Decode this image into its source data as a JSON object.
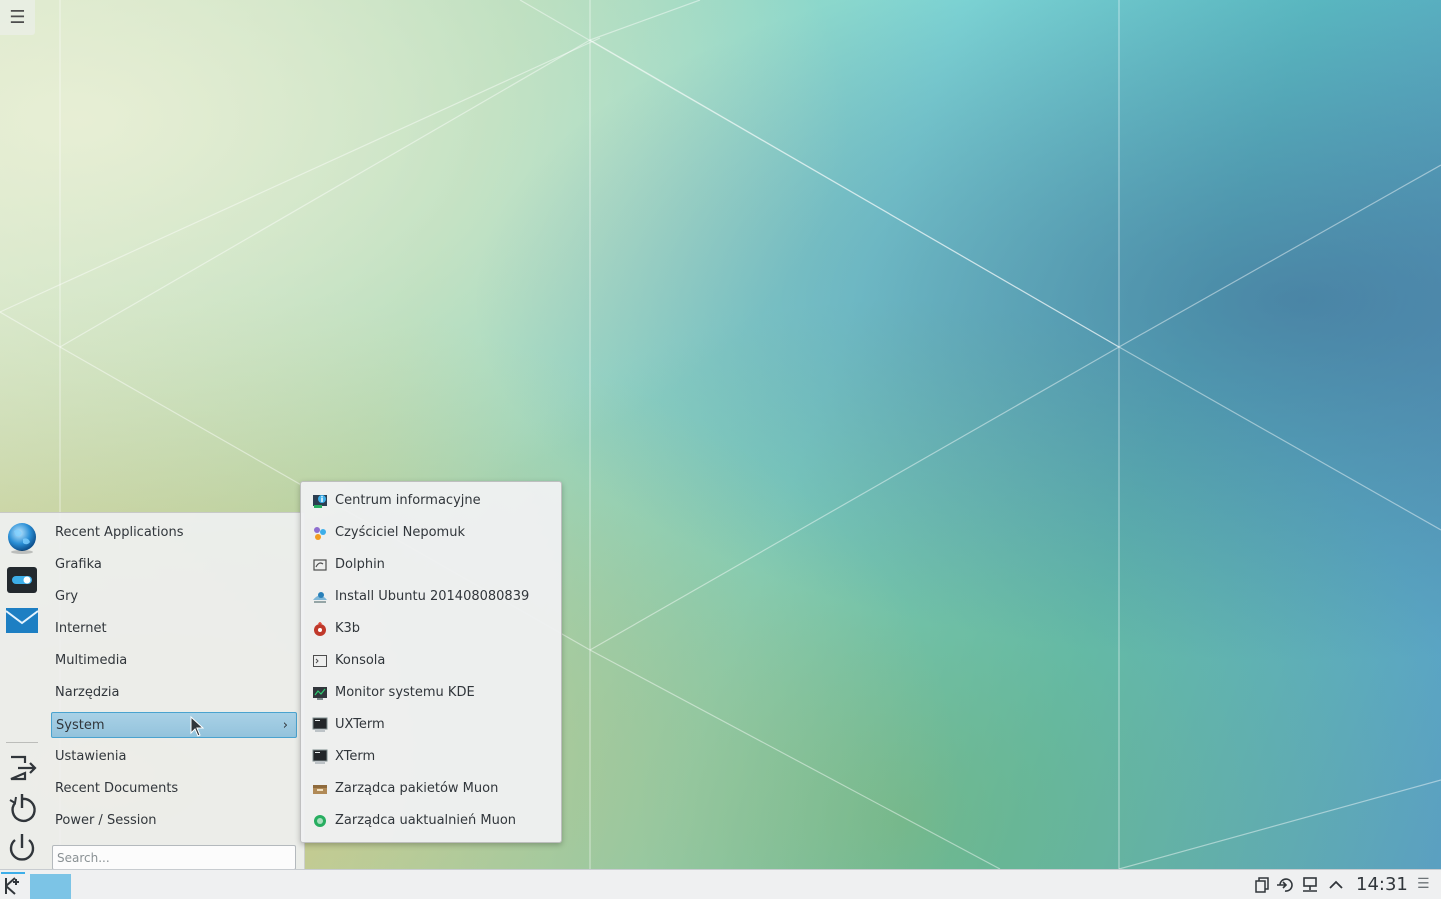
{
  "desktop": {},
  "launcher": {
    "categories": [
      {
        "label": "Recent Applications"
      },
      {
        "label": "Grafika"
      },
      {
        "label": "Gry"
      },
      {
        "label": "Internet"
      },
      {
        "label": "Multimedia"
      },
      {
        "label": "Narzędzia"
      },
      {
        "label": "System",
        "selected": true
      },
      {
        "label": "Ustawienia"
      },
      {
        "label": "Recent Documents"
      },
      {
        "label": "Power / Session"
      }
    ],
    "submenu_arrow": "›",
    "favorites": [
      "globe-icon",
      "system-settings-icon",
      "mail-icon"
    ],
    "session_buttons": [
      "logout-icon",
      "restart-icon",
      "shutdown-icon"
    ],
    "search": {
      "placeholder": "Search..."
    }
  },
  "submenu": {
    "items": [
      {
        "label": "Centrum informacyjne",
        "icon": "info-center-icon"
      },
      {
        "label": "Czyściciel Nepomuk",
        "icon": "nepomuk-icon"
      },
      {
        "label": "Dolphin",
        "icon": "dolphin-icon"
      },
      {
        "label": "Install Ubuntu 201408080839",
        "icon": "ubuntu-install-icon"
      },
      {
        "label": "K3b",
        "icon": "k3b-icon"
      },
      {
        "label": "Konsola",
        "icon": "konsole-icon"
      },
      {
        "label": "Monitor systemu KDE",
        "icon": "system-monitor-icon"
      },
      {
        "label": "UXTerm",
        "icon": "terminal-icon"
      },
      {
        "label": "XTerm",
        "icon": "terminal-icon"
      },
      {
        "label": "Zarządca pakietów Muon",
        "icon": "package-icon"
      },
      {
        "label": "Zarządca uaktualnień Muon",
        "icon": "updater-icon"
      }
    ]
  },
  "panel": {
    "clock": "14:31",
    "tray_icons": [
      "clipboard-icon",
      "kde-connect-icon",
      "network-icon",
      "expand-tray-icon"
    ],
    "accent_color": "#7cc4e6"
  }
}
